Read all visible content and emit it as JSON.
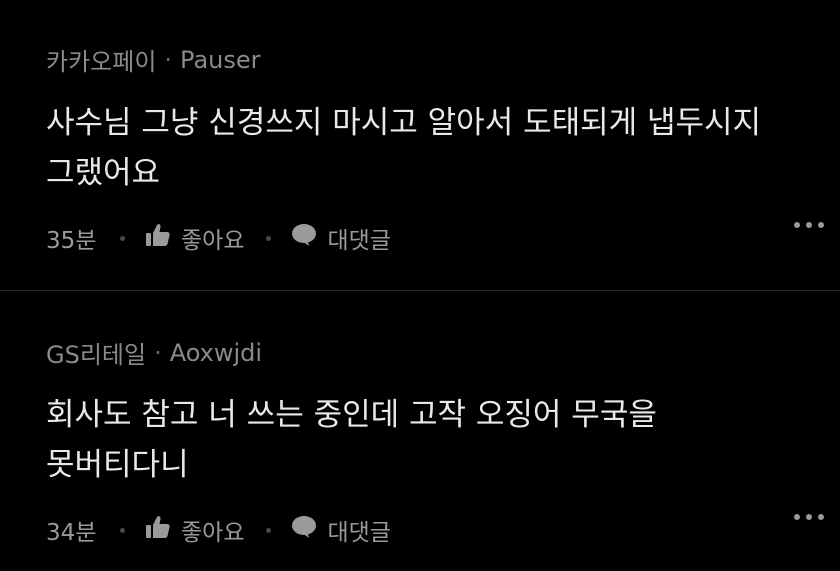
{
  "comments": [
    {
      "author_org": "카카오페이",
      "author_name": "Pauser",
      "text": "사수님 그냥 신경쓰지 마시고 알아서 도태되게 냅두시지 그랬어요",
      "time": "35분",
      "like_label": "좋아요",
      "reply_label": "대댓글"
    },
    {
      "author_org": "GS리테일",
      "author_name": "Aoxwjdi",
      "text": "회사도 참고 너 쓰는 중인데 고작 오징어 무국을 못버티다니",
      "time": "34분",
      "like_label": "좋아요",
      "reply_label": "대댓글"
    }
  ],
  "meta_separator": "·",
  "icons": {
    "like": "thumbs-up-icon",
    "reply": "speech-bubble-icon",
    "more": "more-dots-icon"
  },
  "colors": {
    "background": "#000000",
    "text": "#e9e9e9",
    "muted": "#8a8a8a",
    "divider": "#2a2a2a"
  }
}
